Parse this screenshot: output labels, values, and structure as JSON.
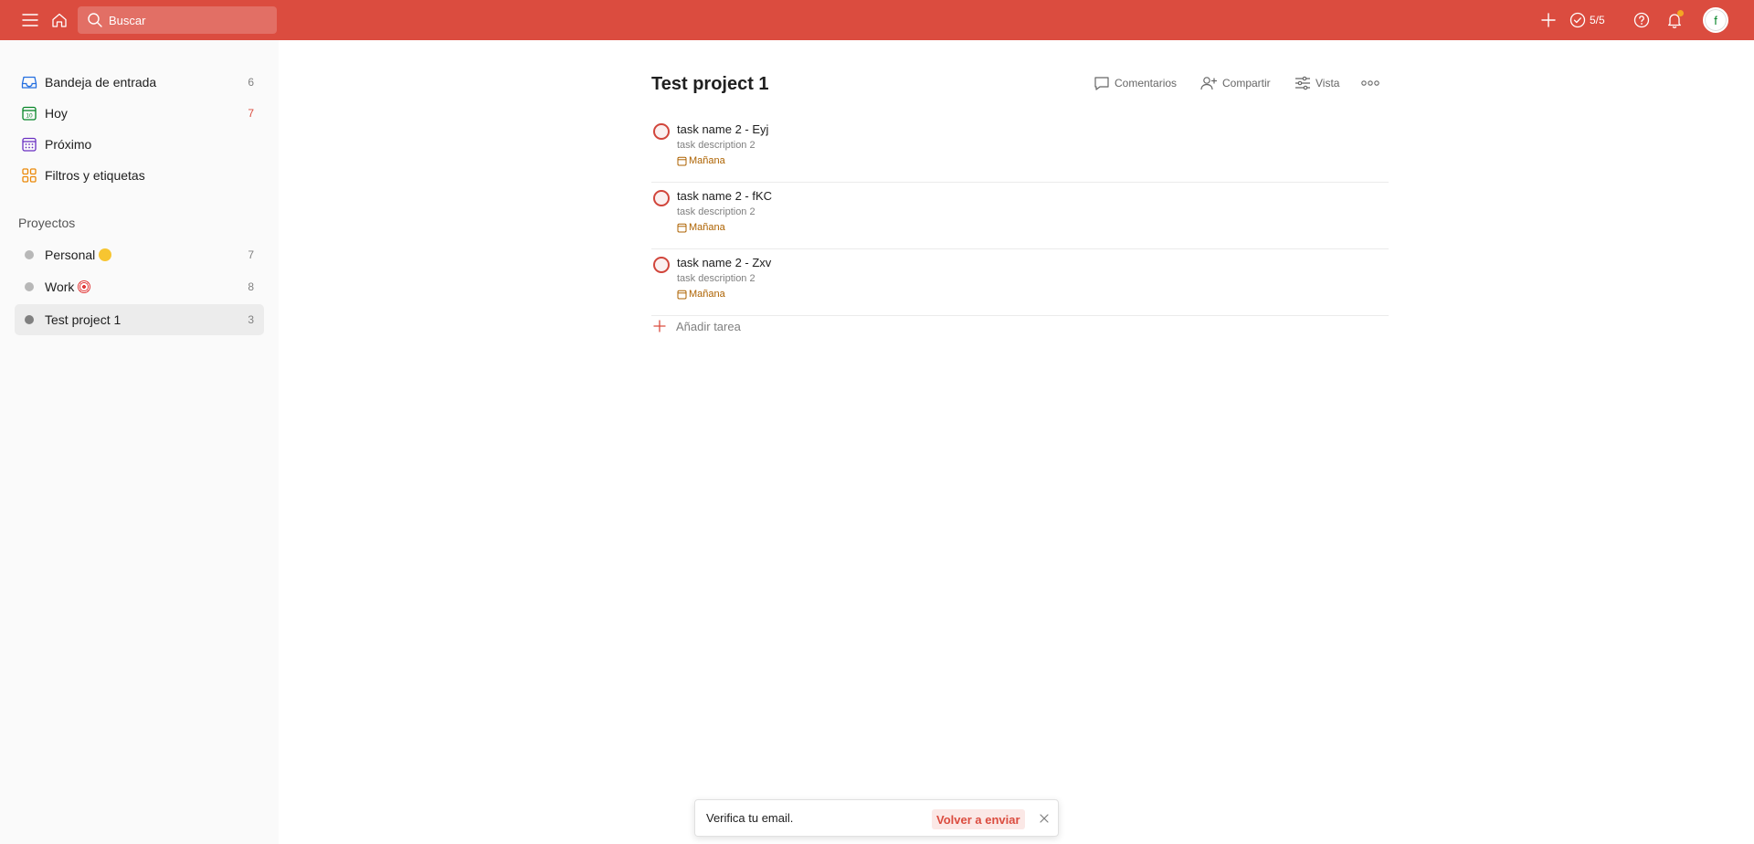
{
  "topbar": {
    "menu_icon": "hamburger-menu-icon",
    "home_icon": "home-icon",
    "search": {
      "placeholder": "Buscar"
    },
    "add_icon": "plus-icon",
    "karma": "5/5",
    "help_icon": "help-icon",
    "bell_icon": "bell-icon",
    "avatar_initial": "f",
    "colors": {
      "bar": "#db4c3f"
    }
  },
  "sidebar": {
    "nav": [
      {
        "label": "Bandeja de entrada",
        "count": "6",
        "icon": "inbox-icon",
        "color": "#246fe0"
      },
      {
        "label": "Hoy",
        "count": "7",
        "icon": "calendar-today-icon",
        "color": "#058527"
      },
      {
        "label": "Próximo",
        "count": "",
        "icon": "calendar-upcoming-icon",
        "color": "#692fc2"
      },
      {
        "label": "Filtros y etiquetas",
        "count": "",
        "icon": "filters-labels-icon",
        "color": "#eb8909"
      }
    ],
    "projects_title": "Proyectos",
    "projects": [
      {
        "label": "Personal",
        "count": "7",
        "emoji": "smile"
      },
      {
        "label": "Work",
        "count": "8",
        "emoji": "target"
      },
      {
        "label": "Test project 1",
        "count": "3",
        "active": true
      }
    ]
  },
  "main": {
    "title": "Test project 1",
    "actions": {
      "comments": "Comentarios",
      "share": "Compartir",
      "view": "Vista",
      "more_icon": "more-horizontal-icon"
    },
    "tasks": [
      {
        "name": "task name 2 - Eyj",
        "description": "task description 2",
        "due": "Mañana"
      },
      {
        "name": "task name 2 - fKC",
        "description": "task description 2",
        "due": "Mañana"
      },
      {
        "name": "task name 2 - Zxv",
        "description": "task description 2",
        "due": "Mañana"
      }
    ],
    "add_task": "Añadir tarea"
  },
  "toast": {
    "message": "Verifica tu email.",
    "action": "Volver a enviar",
    "close_icon": "close-icon"
  }
}
